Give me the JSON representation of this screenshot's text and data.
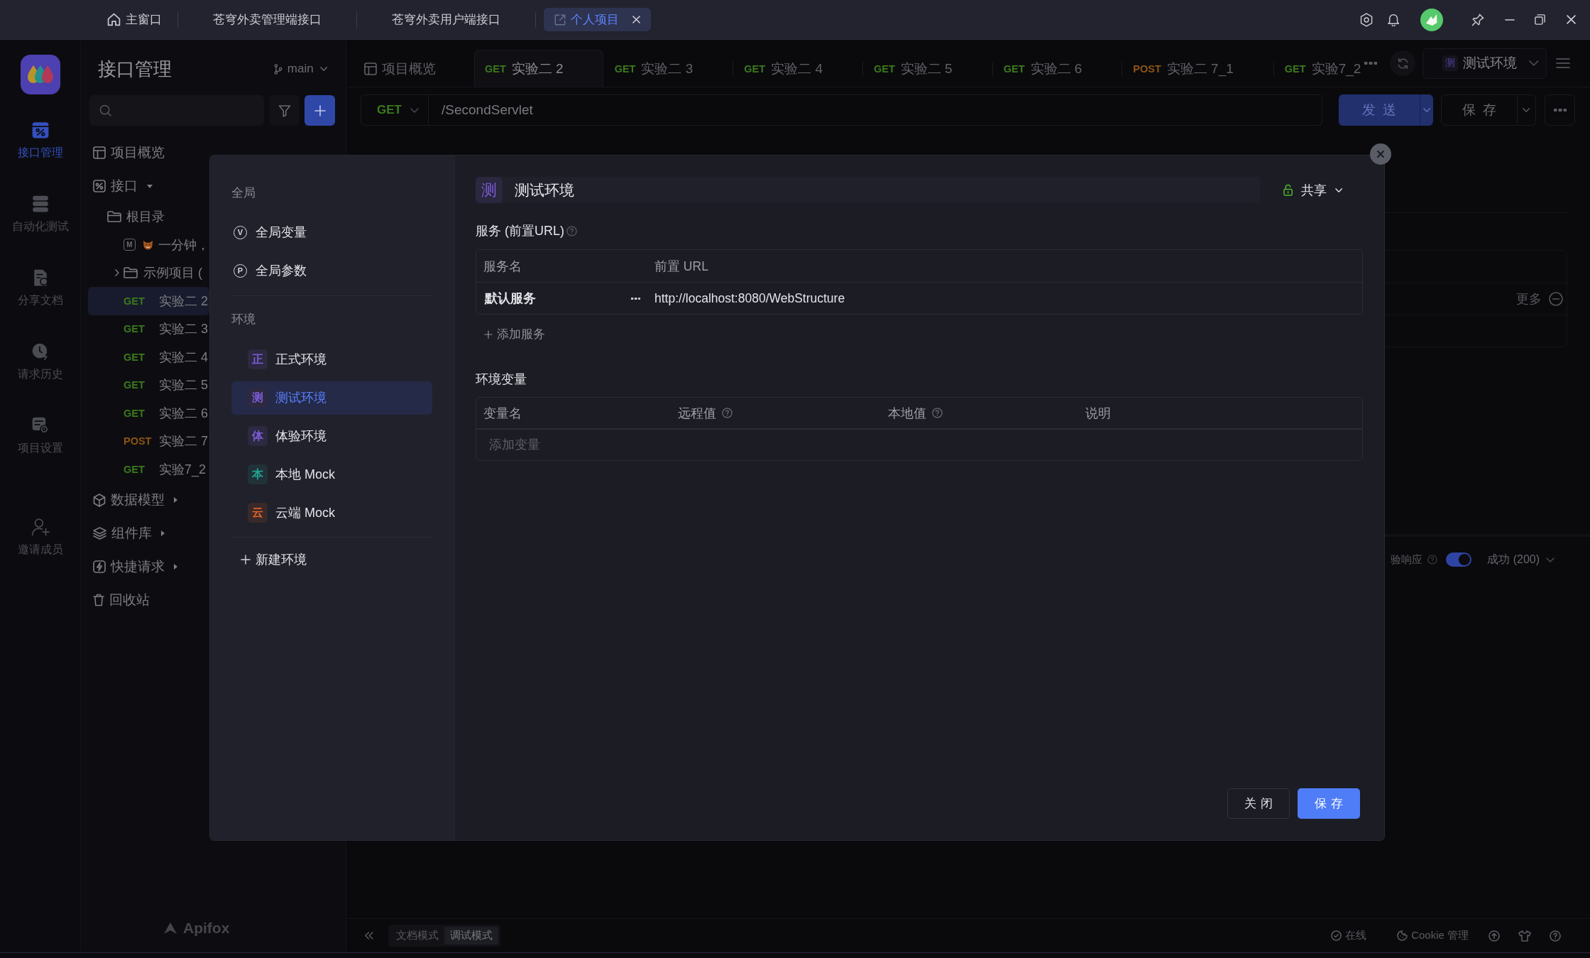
{
  "title_bar": {
    "tabs": [
      {
        "kind": "home",
        "label": "主窗口",
        "selected": false
      },
      {
        "kind": "plain",
        "label": "苍穹外卖管理端接口",
        "selected": false
      },
      {
        "kind": "plain",
        "label": "苍穹外卖用户端接口",
        "selected": false
      },
      {
        "kind": "project",
        "label": "个人项目",
        "selected": true
      }
    ]
  },
  "rail": {
    "nav": [
      {
        "kind": "api",
        "label": "接口管理",
        "selected": true
      },
      {
        "kind": "test",
        "label": "自动化测试",
        "selected": false
      },
      {
        "kind": "docs",
        "label": "分享文档",
        "selected": false
      },
      {
        "kind": "history",
        "label": "请求历史",
        "selected": false
      },
      {
        "kind": "settings",
        "label": "项目设置",
        "selected": false
      }
    ],
    "footer_nav": [
      {
        "kind": "invite",
        "label": "邀请成员",
        "selected": false
      }
    ]
  },
  "sidebar": {
    "title": "接口管理",
    "branch": "main",
    "tree": [
      {
        "kind": "overview",
        "label": "项目概览",
        "selected": false
      },
      {
        "kind": "api",
        "label": "接口",
        "expanded": true,
        "selected": false,
        "children": [
          {
            "kind": "folder",
            "label": "根目录",
            "selected": false,
            "children": [
              {
                "kind": "doc",
                "badge": "M",
                "label": "一分钟，",
                "selected": false
              },
              {
                "kind": "folder",
                "label": "示例项目 (",
                "expanded": false,
                "selected": false
              },
              {
                "kind": "request",
                "method": "GET",
                "color": "#3b7a1c",
                "label": "实验二 2",
                "selected": true
              },
              {
                "kind": "request",
                "method": "GET",
                "color": "#3b7a1c",
                "label": "实验二 3",
                "selected": false
              },
              {
                "kind": "request",
                "method": "GET",
                "color": "#3b7a1c",
                "label": "实验二 4",
                "selected": false
              },
              {
                "kind": "request",
                "method": "GET",
                "color": "#3b7a1c",
                "label": "实验二 5",
                "selected": false
              },
              {
                "kind": "request",
                "method": "GET",
                "color": "#3b7a1c",
                "label": "实验二 6",
                "selected": false
              },
              {
                "kind": "request",
                "method": "POST",
                "color": "#8d5414",
                "label": "实验二 7",
                "selected": false
              },
              {
                "kind": "request",
                "method": "GET",
                "color": "#3b7a1c",
                "label": "实验7_2",
                "selected": false
              }
            ]
          }
        ]
      },
      {
        "kind": "model",
        "label": "数据模型",
        "expanded": false,
        "selected": false
      },
      {
        "kind": "components",
        "label": "组件库",
        "expanded": false,
        "selected": false
      },
      {
        "kind": "quick",
        "label": "快捷请求",
        "expanded": false,
        "selected": false
      },
      {
        "kind": "trash",
        "label": "回收站",
        "selected": false
      }
    ],
    "brand": "Apifox"
  },
  "main": {
    "tabs": [
      {
        "kind": "overview",
        "label": "项目概览",
        "selected": false
      },
      {
        "kind": "request",
        "method": "GET",
        "color": "#3b7a1c",
        "label": "实验二 2",
        "selected": true
      },
      {
        "kind": "request",
        "method": "GET",
        "color": "#3b7a1c",
        "label": "实验二 3",
        "selected": false
      },
      {
        "kind": "request",
        "method": "GET",
        "color": "#3b7a1c",
        "label": "实验二 4",
        "selected": false
      },
      {
        "kind": "request",
        "method": "GET",
        "color": "#3b7a1c",
        "label": "实验二 5",
        "selected": false
      },
      {
        "kind": "request",
        "method": "GET",
        "color": "#3b7a1c",
        "label": "实验二 6",
        "selected": false
      },
      {
        "kind": "request",
        "method": "POST",
        "color": "#8d5414",
        "label": "实验二 7_1",
        "selected": false
      },
      {
        "kind": "request",
        "method": "GET",
        "color": "#3b7a1c",
        "label": "实验7_2",
        "selected": false
      }
    ],
    "environment": {
      "badge": "测",
      "label": "测试环境"
    },
    "request": {
      "method": "GET",
      "color": "#3b7a1c",
      "url": "/SecondServlet",
      "send": "发送",
      "save": "保存"
    },
    "response": {
      "more": "更多",
      "validate": {
        "label": "验响应",
        "on": true
      },
      "status": "成功 (200)"
    },
    "status_bar": {
      "modes": [
        {
          "label": "文档模式",
          "selected": false
        },
        {
          "label": "调试模式",
          "selected": true
        }
      ],
      "online": "在线",
      "cookie": "Cookie 管理"
    }
  },
  "environment_dialog": {
    "global_heading": "全局",
    "global_items": [
      {
        "badge": "V",
        "label": "全局变量",
        "selected": false
      },
      {
        "badge": "P",
        "label": "全局参数",
        "selected": false
      }
    ],
    "env_heading": "环境",
    "environments": [
      {
        "badge": "正",
        "color": "#7b5cd6",
        "label": "正式环境",
        "selected": false
      },
      {
        "badge": "测",
        "color": "#7b5cd6",
        "label": "测试环境",
        "selected": true
      },
      {
        "badge": "体",
        "color": "#7b5cd6",
        "label": "体验环境",
        "selected": false
      },
      {
        "badge": "本",
        "color": "#22a391",
        "label": "本地 Mock",
        "selected": false
      },
      {
        "badge": "云",
        "color": "#e0622c",
        "label": "云端 Mock",
        "selected": false
      }
    ],
    "new_environment": "新建环境",
    "detail": {
      "badge": "测",
      "color": "#7b5cd6",
      "name": "测试环境",
      "share": "共享",
      "services_title": "服务 (前置URL)",
      "service_columns": [
        "服务名",
        "前置 URL"
      ],
      "services": [
        {
          "name": "默认服务",
          "url": "http://localhost:8080/WebStructure"
        }
      ],
      "add_service": "添加服务",
      "variables_title": "环境变量",
      "variable_columns": [
        {
          "label": "变量名",
          "help": false
        },
        {
          "label": "远程值",
          "help": true
        },
        {
          "label": "本地值",
          "help": true
        },
        {
          "label": "说明",
          "help": false
        }
      ],
      "variable_placeholder": "添加变量"
    },
    "buttons": [
      {
        "kind": "secondary",
        "label": "关闭"
      },
      {
        "kind": "primary",
        "label": "保存"
      }
    ]
  }
}
